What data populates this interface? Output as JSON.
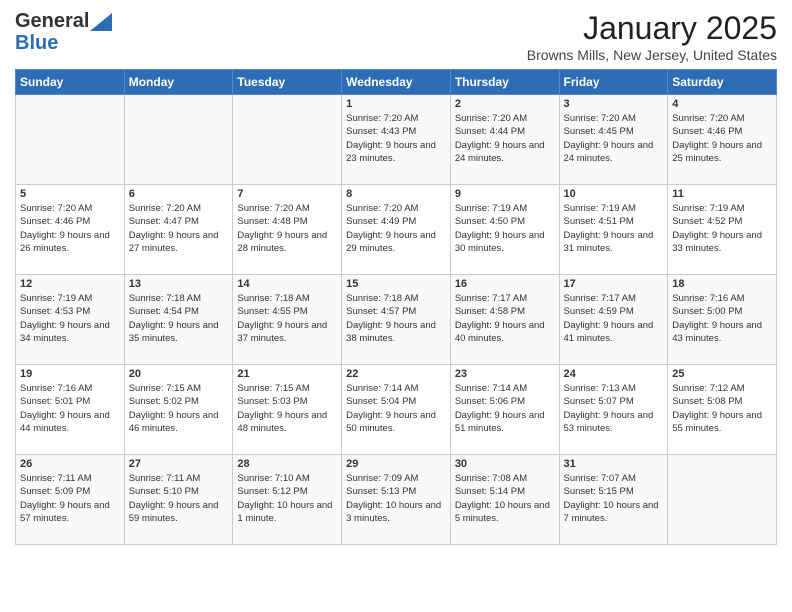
{
  "header": {
    "logo_general": "General",
    "logo_blue": "Blue",
    "month": "January 2025",
    "location": "Browns Mills, New Jersey, United States"
  },
  "days_of_week": [
    "Sunday",
    "Monday",
    "Tuesday",
    "Wednesday",
    "Thursday",
    "Friday",
    "Saturday"
  ],
  "weeks": [
    [
      {
        "day": "",
        "info": ""
      },
      {
        "day": "",
        "info": ""
      },
      {
        "day": "",
        "info": ""
      },
      {
        "day": "1",
        "info": "Sunrise: 7:20 AM\nSunset: 4:43 PM\nDaylight: 9 hours\nand 23 minutes."
      },
      {
        "day": "2",
        "info": "Sunrise: 7:20 AM\nSunset: 4:44 PM\nDaylight: 9 hours\nand 24 minutes."
      },
      {
        "day": "3",
        "info": "Sunrise: 7:20 AM\nSunset: 4:45 PM\nDaylight: 9 hours\nand 24 minutes."
      },
      {
        "day": "4",
        "info": "Sunrise: 7:20 AM\nSunset: 4:46 PM\nDaylight: 9 hours\nand 25 minutes."
      }
    ],
    [
      {
        "day": "5",
        "info": "Sunrise: 7:20 AM\nSunset: 4:46 PM\nDaylight: 9 hours\nand 26 minutes."
      },
      {
        "day": "6",
        "info": "Sunrise: 7:20 AM\nSunset: 4:47 PM\nDaylight: 9 hours\nand 27 minutes."
      },
      {
        "day": "7",
        "info": "Sunrise: 7:20 AM\nSunset: 4:48 PM\nDaylight: 9 hours\nand 28 minutes."
      },
      {
        "day": "8",
        "info": "Sunrise: 7:20 AM\nSunset: 4:49 PM\nDaylight: 9 hours\nand 29 minutes."
      },
      {
        "day": "9",
        "info": "Sunrise: 7:19 AM\nSunset: 4:50 PM\nDaylight: 9 hours\nand 30 minutes."
      },
      {
        "day": "10",
        "info": "Sunrise: 7:19 AM\nSunset: 4:51 PM\nDaylight: 9 hours\nand 31 minutes."
      },
      {
        "day": "11",
        "info": "Sunrise: 7:19 AM\nSunset: 4:52 PM\nDaylight: 9 hours\nand 33 minutes."
      }
    ],
    [
      {
        "day": "12",
        "info": "Sunrise: 7:19 AM\nSunset: 4:53 PM\nDaylight: 9 hours\nand 34 minutes."
      },
      {
        "day": "13",
        "info": "Sunrise: 7:18 AM\nSunset: 4:54 PM\nDaylight: 9 hours\nand 35 minutes."
      },
      {
        "day": "14",
        "info": "Sunrise: 7:18 AM\nSunset: 4:55 PM\nDaylight: 9 hours\nand 37 minutes."
      },
      {
        "day": "15",
        "info": "Sunrise: 7:18 AM\nSunset: 4:57 PM\nDaylight: 9 hours\nand 38 minutes."
      },
      {
        "day": "16",
        "info": "Sunrise: 7:17 AM\nSunset: 4:58 PM\nDaylight: 9 hours\nand 40 minutes."
      },
      {
        "day": "17",
        "info": "Sunrise: 7:17 AM\nSunset: 4:59 PM\nDaylight: 9 hours\nand 41 minutes."
      },
      {
        "day": "18",
        "info": "Sunrise: 7:16 AM\nSunset: 5:00 PM\nDaylight: 9 hours\nand 43 minutes."
      }
    ],
    [
      {
        "day": "19",
        "info": "Sunrise: 7:16 AM\nSunset: 5:01 PM\nDaylight: 9 hours\nand 44 minutes."
      },
      {
        "day": "20",
        "info": "Sunrise: 7:15 AM\nSunset: 5:02 PM\nDaylight: 9 hours\nand 46 minutes."
      },
      {
        "day": "21",
        "info": "Sunrise: 7:15 AM\nSunset: 5:03 PM\nDaylight: 9 hours\nand 48 minutes."
      },
      {
        "day": "22",
        "info": "Sunrise: 7:14 AM\nSunset: 5:04 PM\nDaylight: 9 hours\nand 50 minutes."
      },
      {
        "day": "23",
        "info": "Sunrise: 7:14 AM\nSunset: 5:06 PM\nDaylight: 9 hours\nand 51 minutes."
      },
      {
        "day": "24",
        "info": "Sunrise: 7:13 AM\nSunset: 5:07 PM\nDaylight: 9 hours\nand 53 minutes."
      },
      {
        "day": "25",
        "info": "Sunrise: 7:12 AM\nSunset: 5:08 PM\nDaylight: 9 hours\nand 55 minutes."
      }
    ],
    [
      {
        "day": "26",
        "info": "Sunrise: 7:11 AM\nSunset: 5:09 PM\nDaylight: 9 hours\nand 57 minutes."
      },
      {
        "day": "27",
        "info": "Sunrise: 7:11 AM\nSunset: 5:10 PM\nDaylight: 9 hours\nand 59 minutes."
      },
      {
        "day": "28",
        "info": "Sunrise: 7:10 AM\nSunset: 5:12 PM\nDaylight: 10 hours\nand 1 minute."
      },
      {
        "day": "29",
        "info": "Sunrise: 7:09 AM\nSunset: 5:13 PM\nDaylight: 10 hours\nand 3 minutes."
      },
      {
        "day": "30",
        "info": "Sunrise: 7:08 AM\nSunset: 5:14 PM\nDaylight: 10 hours\nand 5 minutes."
      },
      {
        "day": "31",
        "info": "Sunrise: 7:07 AM\nSunset: 5:15 PM\nDaylight: 10 hours\nand 7 minutes."
      },
      {
        "day": "",
        "info": ""
      }
    ]
  ]
}
